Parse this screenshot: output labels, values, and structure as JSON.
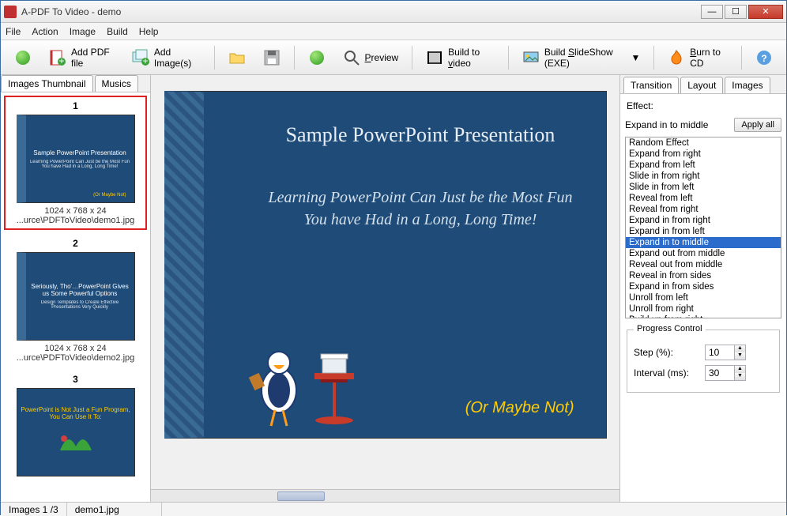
{
  "window": {
    "title": "A-PDF To Video - demo"
  },
  "menu": {
    "file": "File",
    "action": "Action",
    "image": "Image",
    "build": "Build",
    "help": "Help"
  },
  "toolbar": {
    "add_pdf": "Add PDF file",
    "add_images": "Add Image(s)",
    "preview": "Preview",
    "build_video": "Build to video",
    "build_slideshow": "Build SlideShow (EXE)",
    "burn_cd": "Burn to CD"
  },
  "left_tabs": {
    "thumbs": "Images Thumbnail",
    "musics": "Musics"
  },
  "thumbs": [
    {
      "num": "1",
      "title": "Sample PowerPoint Presentation",
      "sub": "Learning PowerPoint Can Just be the Most Fun You have Had in a Long, Long Time!",
      "note": "(Or Maybe Not)",
      "dims": "1024 x 768 x 24",
      "path": "...urce\\PDFToVideo\\demo1.jpg"
    },
    {
      "num": "2",
      "title": "Seriously, Tho'…PowerPoint Gives us Some Powerful Options",
      "sub": "Design Templates to Create Effective Presentations Very Quickly",
      "note": "",
      "dims": "1024 x 768 x 24",
      "path": "...urce\\PDFToVideo\\demo2.jpg"
    },
    {
      "num": "3",
      "title": "PowerPoint is Not Just a Fun Program, You Can Use It To:",
      "sub": "",
      "note": "",
      "dims": "",
      "path": ""
    }
  ],
  "preview_slide": {
    "title": "Sample PowerPoint Presentation",
    "sub": "Learning PowerPoint Can Just be the Most Fun You have Had in a Long, Long Time!",
    "note": "(Or Maybe Not)"
  },
  "right_tabs": {
    "transition": "Transition",
    "layout": "Layout",
    "images": "Images"
  },
  "effect": {
    "label": "Effect:",
    "current": "Expand in to middle",
    "apply_all": "Apply all",
    "list": [
      "Random Effect",
      "Expand from right",
      "Expand from left",
      "Slide in from right",
      "Slide in from left",
      "Reveal from left",
      "Reveal from right",
      "Expand in from right",
      "Expand in from left",
      "Expand in to middle",
      "Expand out from middle",
      "Reveal out from middle",
      "Reveal in from sides",
      "Expand in from sides",
      "Unroll from left",
      "Unroll from right",
      "Build up from right"
    ],
    "selected_index": 9
  },
  "progress": {
    "legend": "Progress Control",
    "step_label": "Step (%):",
    "step_value": "10",
    "interval_label": "Interval (ms):",
    "interval_value": "30"
  },
  "status": {
    "count": "Images 1 /3",
    "file": "demo1.jpg"
  }
}
